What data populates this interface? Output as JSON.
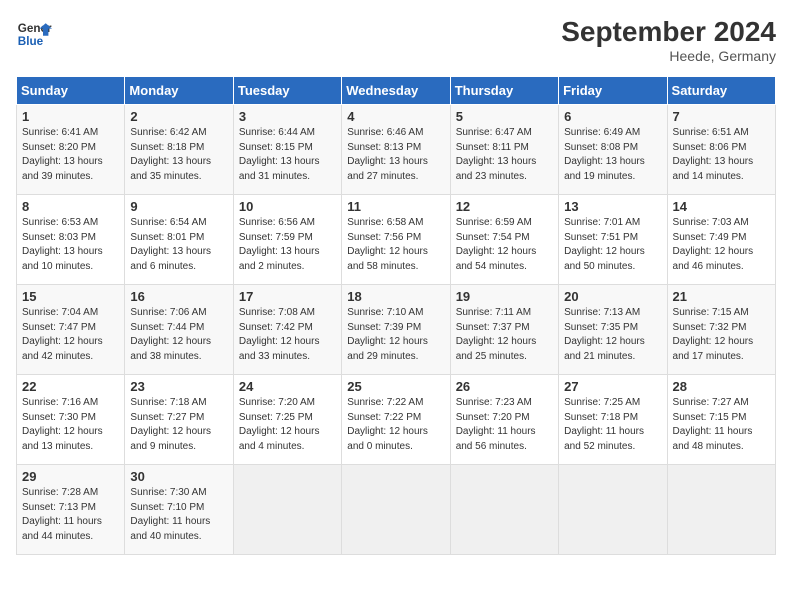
{
  "header": {
    "logo_line1": "General",
    "logo_line2": "Blue",
    "month_year": "September 2024",
    "location": "Heede, Germany"
  },
  "days_of_week": [
    "Sunday",
    "Monday",
    "Tuesday",
    "Wednesday",
    "Thursday",
    "Friday",
    "Saturday"
  ],
  "weeks": [
    [
      {
        "day": "1",
        "text": "Sunrise: 6:41 AM\nSunset: 8:20 PM\nDaylight: 13 hours\nand 39 minutes."
      },
      {
        "day": "2",
        "text": "Sunrise: 6:42 AM\nSunset: 8:18 PM\nDaylight: 13 hours\nand 35 minutes."
      },
      {
        "day": "3",
        "text": "Sunrise: 6:44 AM\nSunset: 8:15 PM\nDaylight: 13 hours\nand 31 minutes."
      },
      {
        "day": "4",
        "text": "Sunrise: 6:46 AM\nSunset: 8:13 PM\nDaylight: 13 hours\nand 27 minutes."
      },
      {
        "day": "5",
        "text": "Sunrise: 6:47 AM\nSunset: 8:11 PM\nDaylight: 13 hours\nand 23 minutes."
      },
      {
        "day": "6",
        "text": "Sunrise: 6:49 AM\nSunset: 8:08 PM\nDaylight: 13 hours\nand 19 minutes."
      },
      {
        "day": "7",
        "text": "Sunrise: 6:51 AM\nSunset: 8:06 PM\nDaylight: 13 hours\nand 14 minutes."
      }
    ],
    [
      {
        "day": "8",
        "text": "Sunrise: 6:53 AM\nSunset: 8:03 PM\nDaylight: 13 hours\nand 10 minutes."
      },
      {
        "day": "9",
        "text": "Sunrise: 6:54 AM\nSunset: 8:01 PM\nDaylight: 13 hours\nand 6 minutes."
      },
      {
        "day": "10",
        "text": "Sunrise: 6:56 AM\nSunset: 7:59 PM\nDaylight: 13 hours\nand 2 minutes."
      },
      {
        "day": "11",
        "text": "Sunrise: 6:58 AM\nSunset: 7:56 PM\nDaylight: 12 hours\nand 58 minutes."
      },
      {
        "day": "12",
        "text": "Sunrise: 6:59 AM\nSunset: 7:54 PM\nDaylight: 12 hours\nand 54 minutes."
      },
      {
        "day": "13",
        "text": "Sunrise: 7:01 AM\nSunset: 7:51 PM\nDaylight: 12 hours\nand 50 minutes."
      },
      {
        "day": "14",
        "text": "Sunrise: 7:03 AM\nSunset: 7:49 PM\nDaylight: 12 hours\nand 46 minutes."
      }
    ],
    [
      {
        "day": "15",
        "text": "Sunrise: 7:04 AM\nSunset: 7:47 PM\nDaylight: 12 hours\nand 42 minutes."
      },
      {
        "day": "16",
        "text": "Sunrise: 7:06 AM\nSunset: 7:44 PM\nDaylight: 12 hours\nand 38 minutes."
      },
      {
        "day": "17",
        "text": "Sunrise: 7:08 AM\nSunset: 7:42 PM\nDaylight: 12 hours\nand 33 minutes."
      },
      {
        "day": "18",
        "text": "Sunrise: 7:10 AM\nSunset: 7:39 PM\nDaylight: 12 hours\nand 29 minutes."
      },
      {
        "day": "19",
        "text": "Sunrise: 7:11 AM\nSunset: 7:37 PM\nDaylight: 12 hours\nand 25 minutes."
      },
      {
        "day": "20",
        "text": "Sunrise: 7:13 AM\nSunset: 7:35 PM\nDaylight: 12 hours\nand 21 minutes."
      },
      {
        "day": "21",
        "text": "Sunrise: 7:15 AM\nSunset: 7:32 PM\nDaylight: 12 hours\nand 17 minutes."
      }
    ],
    [
      {
        "day": "22",
        "text": "Sunrise: 7:16 AM\nSunset: 7:30 PM\nDaylight: 12 hours\nand 13 minutes."
      },
      {
        "day": "23",
        "text": "Sunrise: 7:18 AM\nSunset: 7:27 PM\nDaylight: 12 hours\nand 9 minutes."
      },
      {
        "day": "24",
        "text": "Sunrise: 7:20 AM\nSunset: 7:25 PM\nDaylight: 12 hours\nand 4 minutes."
      },
      {
        "day": "25",
        "text": "Sunrise: 7:22 AM\nSunset: 7:22 PM\nDaylight: 12 hours\nand 0 minutes."
      },
      {
        "day": "26",
        "text": "Sunrise: 7:23 AM\nSunset: 7:20 PM\nDaylight: 11 hours\nand 56 minutes."
      },
      {
        "day": "27",
        "text": "Sunrise: 7:25 AM\nSunset: 7:18 PM\nDaylight: 11 hours\nand 52 minutes."
      },
      {
        "day": "28",
        "text": "Sunrise: 7:27 AM\nSunset: 7:15 PM\nDaylight: 11 hours\nand 48 minutes."
      }
    ],
    [
      {
        "day": "29",
        "text": "Sunrise: 7:28 AM\nSunset: 7:13 PM\nDaylight: 11 hours\nand 44 minutes."
      },
      {
        "day": "30",
        "text": "Sunrise: 7:30 AM\nSunset: 7:10 PM\nDaylight: 11 hours\nand 40 minutes."
      },
      {
        "day": "",
        "text": ""
      },
      {
        "day": "",
        "text": ""
      },
      {
        "day": "",
        "text": ""
      },
      {
        "day": "",
        "text": ""
      },
      {
        "day": "",
        "text": ""
      }
    ]
  ]
}
